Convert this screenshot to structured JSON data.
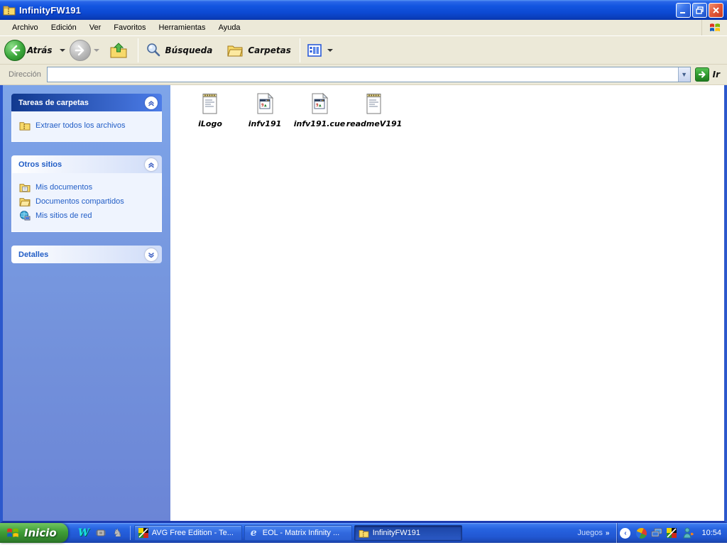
{
  "window": {
    "title": "InfinityFW191",
    "buttons": {
      "minimize": "_",
      "restore": "restore",
      "close": "close"
    },
    "menu": {
      "items": [
        "Archivo",
        "Edición",
        "Ver",
        "Favoritos",
        "Herramientas",
        "Ayuda"
      ]
    },
    "toolbar": {
      "back_label": "Atrás",
      "search_label": "Búsqueda",
      "folders_label": "Carpetas"
    },
    "address": {
      "label": "Dirección",
      "value": "",
      "go_label": "Ir"
    }
  },
  "sidebar": {
    "panels": [
      {
        "title": "Tareas de carpetas",
        "state": "expanded",
        "items": [
          {
            "label": "Extraer todos los archivos",
            "icon": "zip-folder-icon"
          }
        ]
      },
      {
        "title": "Otros sitios",
        "state": "expanded",
        "items": [
          {
            "label": "Mis documentos",
            "icon": "my-documents-icon"
          },
          {
            "label": "Documentos compartidos",
            "icon": "shared-folder-icon"
          },
          {
            "label": "Mis sitios de red",
            "icon": "network-places-icon"
          }
        ]
      },
      {
        "title": "Detalles",
        "state": "collapsed",
        "items": []
      }
    ]
  },
  "files": [
    {
      "name": "iLogo",
      "icon": "notepad-file-icon"
    },
    {
      "name": "infv191",
      "icon": "unknown-file-icon"
    },
    {
      "name": "infv191.cue",
      "icon": "unknown-file-icon"
    },
    {
      "name": "readmeV191",
      "icon": "notepad-file-icon"
    }
  ],
  "taskbar": {
    "start_label": "Inicio",
    "quick_launch": [
      "w-app-icon",
      "chip-icon",
      "chess-knight-icon"
    ],
    "tasks": [
      {
        "label": "AVG Free Edition - Te...",
        "icon": "avg-icon",
        "active": false
      },
      {
        "label": "EOL - Matrix Infinity ...",
        "icon": "internet-explorer-icon",
        "active": false
      },
      {
        "label": "InfinityFW191",
        "icon": "zip-folder-icon",
        "active": true
      }
    ],
    "toolbar_label": "Juegos",
    "overflow_chevron": "»",
    "clock": "10:54"
  },
  "colors": {
    "titlebar_blue": "#0c49d2",
    "menubar_beige": "#ece9d8",
    "sidebar_blue": "#7493dc",
    "panel_header_dark": "#11398f",
    "link_blue": "#215dc6",
    "taskbar_blue": "#2157d2",
    "start_green": "#3f9e37",
    "close_red": "#e25b3c"
  }
}
